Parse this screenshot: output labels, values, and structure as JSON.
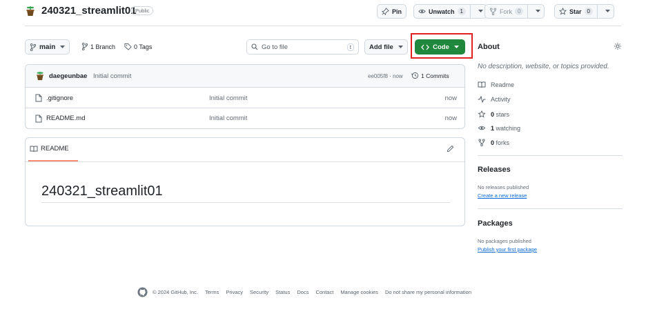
{
  "repo": {
    "name": "240321_streamlit01",
    "visibility": "Public"
  },
  "header_actions": {
    "pin_label": "Pin",
    "unwatch_label": "Unwatch",
    "unwatch_count": "1",
    "fork_label": "Fork",
    "fork_count": "0",
    "star_label": "Star",
    "star_count": "0"
  },
  "toolbar": {
    "branch": "main",
    "branches_label": "1 Branch",
    "tags_label": "0 Tags",
    "go_to_file_placeholder": "Go to file",
    "go_to_file_shortcut": "t",
    "add_file_label": "Add file",
    "code_label": "Code"
  },
  "commit": {
    "author": "daegeunbae",
    "message": "Initial commit",
    "hash_time": "ee005f8 · now",
    "commits_label": "1 Commits"
  },
  "files": [
    {
      "name": ".gitignore",
      "message": "Initial commit",
      "time": "now"
    },
    {
      "name": "README.md",
      "message": "Initial commit",
      "time": "now"
    }
  ],
  "readme": {
    "tab_label": "README",
    "heading": "240321_streamlit01"
  },
  "about": {
    "title": "About",
    "description": "No description, website, or topics provided.",
    "items": [
      {
        "icon": "book-icon",
        "bold": "",
        "text": "Readme"
      },
      {
        "icon": "activity-icon",
        "bold": "",
        "text": "Activity"
      },
      {
        "icon": "star-icon",
        "bold": "0",
        "text": "stars"
      },
      {
        "icon": "eye-icon",
        "bold": "1",
        "text": "watching"
      },
      {
        "icon": "fork-icon",
        "bold": "0",
        "text": "forks"
      }
    ]
  },
  "releases": {
    "title": "Releases",
    "empty": "No releases published",
    "link": "Create a new release"
  },
  "packages": {
    "title": "Packages",
    "empty": "No packages published",
    "link": "Publish your first package"
  },
  "footer": {
    "copyright": "© 2024 GitHub, Inc.",
    "links": [
      "Terms",
      "Privacy",
      "Security",
      "Status",
      "Docs",
      "Contact",
      "Manage cookies",
      "Do not share my personal information"
    ]
  },
  "colors": {
    "code_button": "#1f883d",
    "highlight_box": "#e0201f",
    "link": "#0969da",
    "readme_underline": "#fd8c73"
  }
}
